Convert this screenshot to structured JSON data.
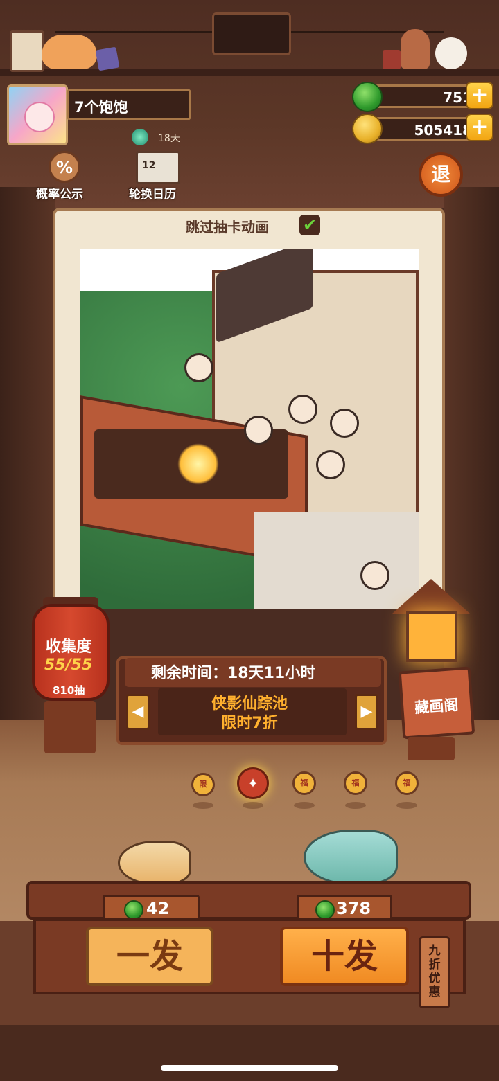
{
  "profile": {
    "name": "7个饱饱",
    "vip_days": "18天"
  },
  "currency": {
    "jade": "751",
    "coins": "505418",
    "plus_symbol": "+"
  },
  "menu": {
    "probability_label": "概率公示",
    "probability_icon_text": "%",
    "calendar_label": "轮换日历",
    "calendar_icon_text": "12",
    "exit_label": "退"
  },
  "gacha": {
    "skip_animation_label": "跳过抽卡动画",
    "skip_checked": true,
    "check_mark": "✔"
  },
  "collection": {
    "title": "收集度",
    "progress": "55/55",
    "draws": "810抽"
  },
  "banner": {
    "remaining_time": "剩余时间：18天11小时",
    "pool_name": "侠影仙踪池",
    "discount": "限时7折"
  },
  "gallery": {
    "label": "藏画阁"
  },
  "pool_selector": {
    "active_index": 1,
    "items": [
      {
        "label": "限"
      },
      {
        "label": "✦"
      },
      {
        "label": "福"
      },
      {
        "label": "福"
      },
      {
        "label": "福"
      }
    ]
  },
  "draw": {
    "single_price": "42",
    "single_label": "一发",
    "ten_price": "378",
    "ten_label": "十发",
    "sale_tag": "九折优惠"
  },
  "colors": {
    "accent_orange": "#f08a22",
    "jade_green": "#2f9a2c",
    "gold": "#ffd34a",
    "wood_dark": "#4a2014"
  },
  "icons": {
    "avatar": "avatar-image",
    "jade": "jade-icon",
    "coin": "coin-icon",
    "vip": "vip-badge-icon",
    "probability": "percent-gear-icon",
    "calendar": "calendar-icon",
    "exit": "exit-icon",
    "lantern": "lantern-icon",
    "lamp": "lamp-icon"
  }
}
